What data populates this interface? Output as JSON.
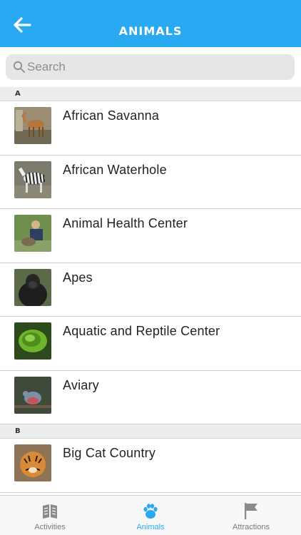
{
  "header": {
    "title": "ANIMALS",
    "back_icon": "arrow-left-icon"
  },
  "search": {
    "placeholder": "Search",
    "value": ""
  },
  "sections": [
    {
      "letter": "A",
      "items": [
        {
          "label": "African Savanna",
          "thumb": "antelope"
        },
        {
          "label": "African Waterhole",
          "thumb": "zebra"
        },
        {
          "label": "Animal Health Center",
          "thumb": "vet"
        },
        {
          "label": "Apes",
          "thumb": "gorilla"
        },
        {
          "label": "Aquatic and Reptile Center",
          "thumb": "snake"
        },
        {
          "label": "Aviary",
          "thumb": "bird"
        }
      ]
    },
    {
      "letter": "B",
      "items": [
        {
          "label": "Big Cat Country",
          "thumb": "tiger"
        }
      ]
    }
  ],
  "tabs": [
    {
      "label": "Activities",
      "icon": "book-icon",
      "active": false
    },
    {
      "label": "Animals",
      "icon": "paw-icon",
      "active": true
    },
    {
      "label": "Attractions",
      "icon": "flag-icon",
      "active": false
    }
  ],
  "colors": {
    "accent": "#2AA9F3",
    "section_bg": "#EDEDED",
    "search_bg": "#E6E6E6"
  }
}
